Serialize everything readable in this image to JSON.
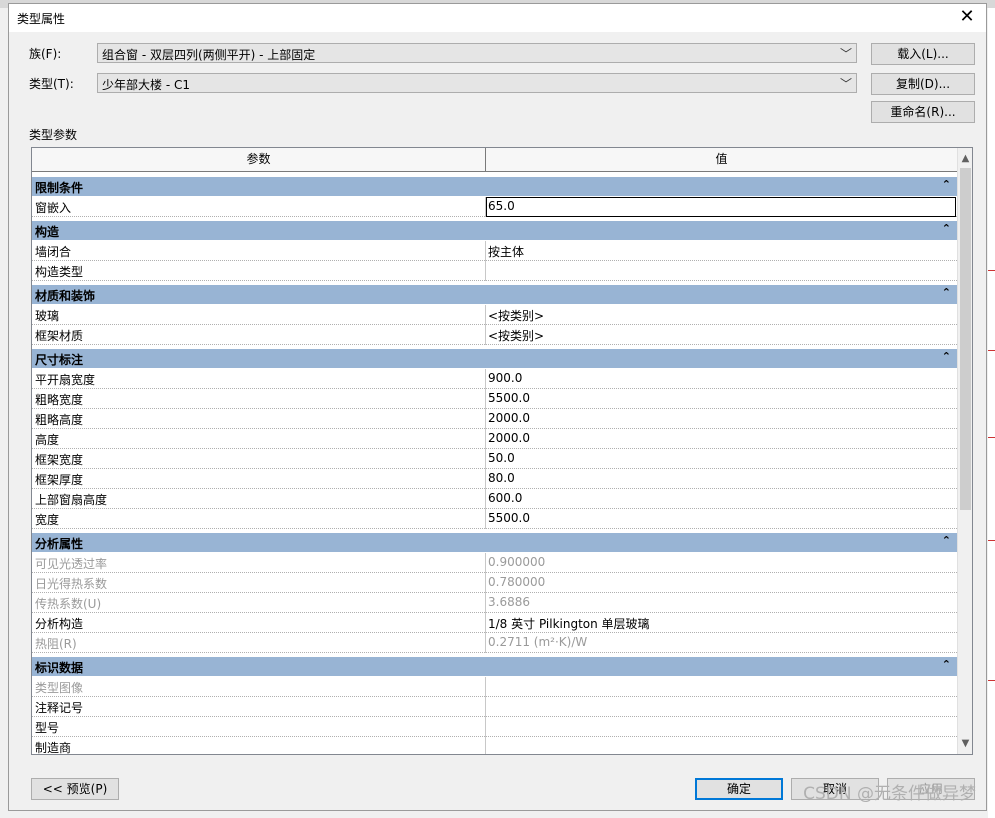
{
  "dialog": {
    "title": "类型属性",
    "close": "✕"
  },
  "family": {
    "label": "族(F):",
    "value": "组合窗 - 双层四列(两侧平开) - 上部固定"
  },
  "type": {
    "label": "类型(T):",
    "value": "少年部大楼 - C1"
  },
  "buttons": {
    "load": "载入(L)...",
    "duplicate": "复制(D)...",
    "rename": "重命名(R)...",
    "preview": "<< 预览(P)",
    "ok": "确定",
    "cancel": "取消",
    "apply": "应用"
  },
  "section_label": "类型参数",
  "grid": {
    "col_param": "参数",
    "col_value": "值",
    "groups": [
      {
        "name": "限制条件",
        "rows": [
          {
            "name": "窗嵌入",
            "value": "65.0",
            "editing": true
          }
        ]
      },
      {
        "name": "构造",
        "rows": [
          {
            "name": "墙闭合",
            "value": "按主体"
          },
          {
            "name": "构造类型",
            "value": ""
          }
        ]
      },
      {
        "name": "材质和装饰",
        "rows": [
          {
            "name": "玻璃",
            "value": "<按类别>"
          },
          {
            "name": "框架材质",
            "value": "<按类别>"
          }
        ]
      },
      {
        "name": "尺寸标注",
        "rows": [
          {
            "name": "平开扇宽度",
            "value": "900.0"
          },
          {
            "name": "粗略宽度",
            "value": "5500.0"
          },
          {
            "name": "粗略高度",
            "value": "2000.0"
          },
          {
            "name": "高度",
            "value": "2000.0"
          },
          {
            "name": "框架宽度",
            "value": "50.0"
          },
          {
            "name": "框架厚度",
            "value": "80.0"
          },
          {
            "name": "上部窗扇高度",
            "value": "600.0"
          },
          {
            "name": "宽度",
            "value": "5500.0"
          }
        ]
      },
      {
        "name": "分析属性",
        "rows": [
          {
            "name": "可见光透过率",
            "value": "0.900000",
            "dim": true
          },
          {
            "name": "日光得热系数",
            "value": "0.780000",
            "dim": true
          },
          {
            "name": "传热系数(U)",
            "value": "3.6886",
            "dim": true
          },
          {
            "name": "分析构造",
            "value": "1/8 英寸 Pilkington 单层玻璃"
          },
          {
            "name": "热阻(R)",
            "value": "0.2711 (m²·K)/W",
            "dim": true
          }
        ]
      },
      {
        "name": "标识数据",
        "rows": [
          {
            "name": "类型图像",
            "value": "",
            "dim": true
          },
          {
            "name": "注释记号",
            "value": ""
          },
          {
            "name": "型号",
            "value": ""
          },
          {
            "name": "制造商",
            "value": ""
          }
        ]
      }
    ]
  },
  "watermark": "CSDN @无条件做异梦"
}
